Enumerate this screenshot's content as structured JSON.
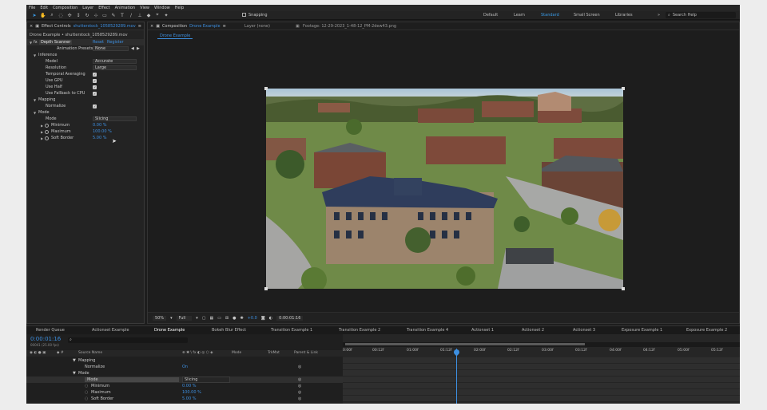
{
  "menu": [
    "File",
    "Edit",
    "Composition",
    "Layer",
    "Effect",
    "Animation",
    "View",
    "Window",
    "Help"
  ],
  "toolbar": {
    "snapping_label": "Snapping"
  },
  "workspaces": [
    "Default",
    "Learn",
    "Standard",
    "Small Screen",
    "Libraries"
  ],
  "active_workspace": "Standard",
  "search_placeholder": "Search Help",
  "effect_controls": {
    "tab_label": "Effect Controls",
    "file_name": "shutterstock_1058529289.mov",
    "layer_path": "Drone Example • shutterstock_1058529289.mov",
    "effect_name": "Depth Scanner",
    "reset_label": "Reset",
    "register_label": "Register",
    "animation_presets_label": "Animation Presets:",
    "animation_presets_value": "None",
    "inference_label": "Inference",
    "model_label": "Model",
    "model_value": "Accurate",
    "resolution_label": "Resolution",
    "resolution_value": "Large",
    "temporal_label": "Temporal Averaging",
    "gpu_label": "Use GPU",
    "half_label": "Use Half",
    "fallback_label": "Use Fallback to CPU",
    "mapping_label": "Mapping",
    "normalize_label": "Normalize",
    "mode_group_label": "Mode",
    "mode_label": "Mode",
    "mode_value": "Slicing",
    "minimum_label": "Minimum",
    "minimum_value": "0.00 %",
    "maximum_label": "Maximum",
    "maximum_value": "100.00 %",
    "soft_border_label": "Soft Border",
    "soft_border_value": "5.00 %"
  },
  "composition": {
    "tab_label": "Composition",
    "comp_name": "Drone Example",
    "layer_label": "Layer (none)",
    "footage_label": "Footage: 12-29-2023_1-48-12_PM-2dew43.png",
    "sub_tab": "Drone Example",
    "zoom": "50%",
    "resolution": "Full",
    "exposure": "+0.0",
    "timecode": "0:00:01:16"
  },
  "timeline": {
    "tabs": [
      "Render Queue",
      "Actionset Example",
      "Drone Example",
      "Bokeh Blur Effect",
      "Transition Example 1",
      "Transition Example 2",
      "Transition Example 4",
      "Actionset 1",
      "Actionset 2",
      "Actionset 3",
      "Exposure Example 1",
      "Exposure Example 2"
    ],
    "active_tab": "Drone Example",
    "timecode": "0:00:01:16",
    "frame_info": "00041 (25.00 fps)",
    "columns": [
      "Source Name",
      "Mode",
      "TrkMat",
      "Parent & Link"
    ],
    "ruler": [
      "0:00f",
      "00:12f",
      "01:00f",
      "01:12f",
      "02:00f",
      "02:12f",
      "03:00f",
      "03:12f",
      "04:00f",
      "04:12f",
      "05:00f",
      "05:12f"
    ],
    "rows": [
      {
        "label": "Mapping",
        "value": ""
      },
      {
        "label": "Normalize",
        "value": "On"
      },
      {
        "label": "Mode",
        "value": ""
      },
      {
        "label": "Mode",
        "value": "Slicing"
      },
      {
        "label": "Minimum",
        "value": "0.00 %"
      },
      {
        "label": "Maximum",
        "value": "100.00 %"
      },
      {
        "label": "Soft Border",
        "value": "5.00 %"
      }
    ]
  }
}
